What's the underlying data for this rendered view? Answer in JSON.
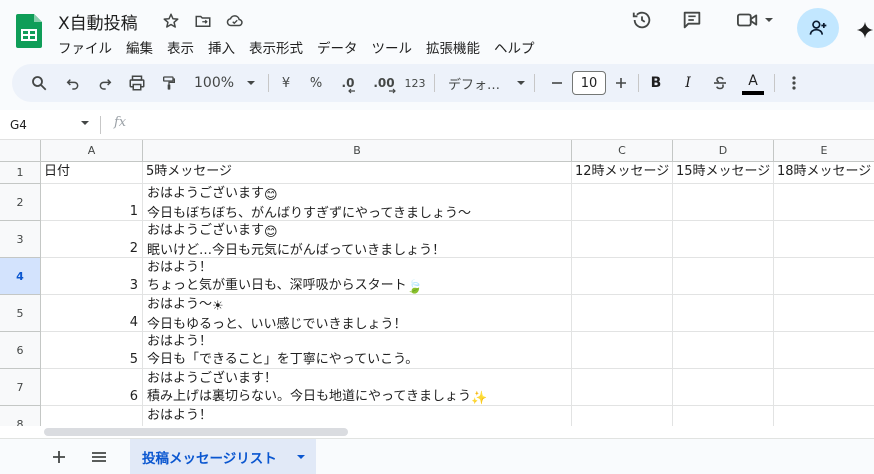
{
  "doc": {
    "title": "X自動投稿"
  },
  "menu": [
    "ファイル",
    "編集",
    "表示",
    "挿入",
    "表示形式",
    "データ",
    "ツール",
    "拡張機能",
    "ヘルプ"
  ],
  "toolbar": {
    "zoom": "100%",
    "currency": "¥",
    "percent": "%",
    "dec_decrease": ".0",
    "dec_increase": ".00",
    "number_format": "123",
    "font": "デフォ…",
    "font_size": "10",
    "text_color_label": "A",
    "text_color": "#000000"
  },
  "formula_bar": {
    "name_box": "G4",
    "fx_label": "fx",
    "value": ""
  },
  "grid": {
    "columns": [
      "A",
      "B",
      "C",
      "D",
      "E"
    ],
    "rows": [
      {
        "n": "1",
        "a": "日付",
        "b1": "5時メッセージ",
        "b2": "",
        "b_emoji": "",
        "c": "12時メッセージ",
        "d": "15時メッセージ",
        "e": "18時メッセージ"
      },
      {
        "n": "2",
        "a": "1",
        "b1": "おはようございます",
        "b1_emoji": "😊",
        "b2": "今日もぼちぼち、がんばりすぎずにやってきましょう〜",
        "b2_emoji": ""
      },
      {
        "n": "3",
        "a": "2",
        "b1": "おはようございます",
        "b1_emoji": "😊",
        "b2": "眠いけど…今日も元気にがんばっていきましょう！",
        "b2_emoji": ""
      },
      {
        "n": "4",
        "a": "3",
        "b1": "おはよう！",
        "b1_emoji": "",
        "b2": "ちょっと気が重い日も、深呼吸からスタート",
        "b2_emoji": "🍃"
      },
      {
        "n": "5",
        "a": "4",
        "b1": "おはよう〜",
        "b1_emoji": "☀",
        "b2": "今日もゆるっと、いい感じでいきましょう！",
        "b2_emoji": ""
      },
      {
        "n": "6",
        "a": "5",
        "b1": "おはよう！",
        "b1_emoji": "",
        "b2": "今日も「できること」を丁寧にやっていこう。",
        "b2_emoji": ""
      },
      {
        "n": "7",
        "a": "6",
        "b1": "おはようございます！",
        "b1_emoji": "",
        "b2": "積み上げは裏切らない。今日も地道にやってきましょう",
        "b2_emoji": "✨"
      },
      {
        "n": "8",
        "a": "",
        "b1": "おはよう！",
        "b1_emoji": "",
        "b2": "",
        "b2_emoji": ""
      }
    ],
    "selected_row": "4"
  },
  "sheets": {
    "active": "投稿メッセージリスト"
  },
  "colors": {
    "accent": "#0b57d0",
    "share_bg": "#c2e7ff",
    "logo_green": "#0f9d58"
  }
}
